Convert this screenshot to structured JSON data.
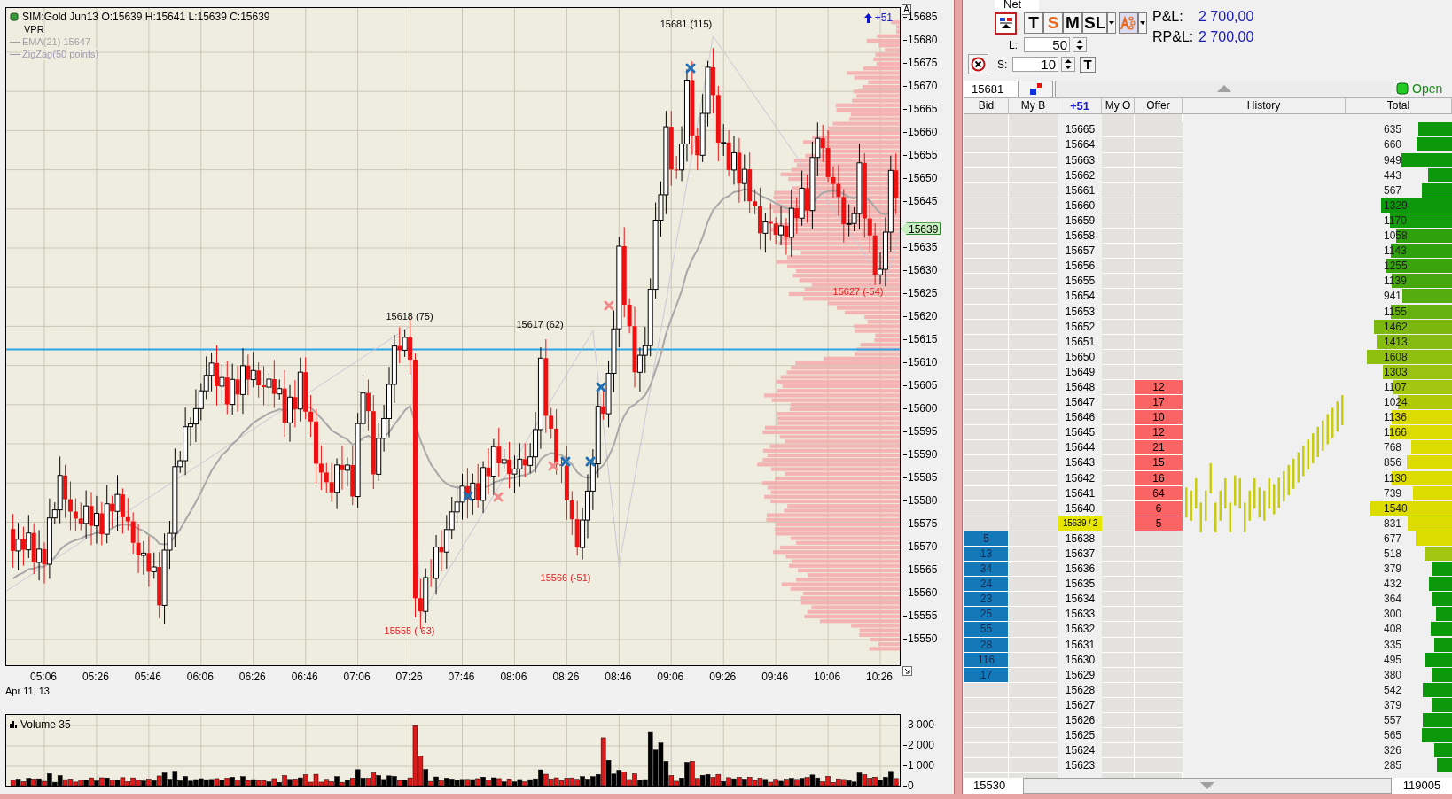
{
  "chart": {
    "legend": {
      "instrument": "SIM:Gold Jun13 O:15639 H:15641 L:15639 C:15639",
      "indicators": [
        {
          "label": "VPR",
          "kind": "plain",
          "color": "#000000"
        },
        {
          "label": "EMA(21)  15647",
          "kind": "line",
          "color": "#a0a0a0"
        },
        {
          "label": "ZigZag(50 points)",
          "kind": "line",
          "color": "#9a9ab4"
        }
      ]
    },
    "position_change": "+51",
    "axis_button": "A",
    "y_axis_labels": [
      "15685",
      "15680",
      "15675",
      "15670",
      "15665",
      "15660",
      "15655",
      "15650",
      "15645",
      "15635",
      "15630",
      "15625",
      "15620",
      "15615",
      "15610",
      "15605",
      "15600",
      "15595",
      "15590",
      "15585",
      "15580",
      "15575",
      "15570",
      "15565",
      "15560",
      "15555",
      "15550"
    ],
    "price_tag": "15639",
    "annotations": [
      "15681 (115)",
      "15618 (75)",
      "15617 (62)",
      "15555 (-63)",
      "15566 (-51)",
      "15627 (-54)"
    ],
    "time_labels": [
      "05:06",
      "05:26",
      "05:46",
      "06:06",
      "06:26",
      "06:46",
      "07:06",
      "07:26",
      "07:46",
      "08:06",
      "08:26",
      "08:46",
      "09:06",
      "09:26",
      "09:46",
      "10:06",
      "10:26"
    ],
    "date_label": "Apr 11, 13",
    "volume": {
      "title": "Volume 35",
      "y_axis_labels": [
        "3 000",
        "2 000",
        "1 000",
        "0"
      ]
    }
  },
  "order_entry": {
    "account": "Net",
    "buttons": [
      {
        "label": "T",
        "color": "#000000"
      },
      {
        "label": "S",
        "color": "#e8661a"
      },
      {
        "label": "M",
        "color": "#000000"
      },
      {
        "label": "SL",
        "color": "#000000"
      }
    ],
    "pnl_label": "P&L:",
    "pnl": "2 700,00",
    "rpnl_label": "RP&L:",
    "rpnl": "2 700,00",
    "long_label": "L:",
    "long_qty": "50",
    "short_label": "S:",
    "short_qty": "10",
    "trail_button": "T"
  },
  "ladder": {
    "top_price": "15681",
    "status": "Open",
    "columns": [
      {
        "label": "Bid",
        "kind": "plain"
      },
      {
        "label": "My B",
        "kind": "plain"
      },
      {
        "label": "+51",
        "kind": "position"
      },
      {
        "label": "My O",
        "kind": "plain"
      },
      {
        "label": "Offer",
        "kind": "plain"
      },
      {
        "label": "History",
        "kind": "plain"
      },
      {
        "label": "Total",
        "kind": "plain"
      }
    ],
    "rows": [
      {
        "price": "15665",
        "total": "635",
        "color": "#0b990b",
        "current": false
      },
      {
        "price": "15664",
        "total": "660",
        "color": "#0b990b",
        "current": false
      },
      {
        "price": "15663",
        "total": "949",
        "color": "#0b990b",
        "current": false
      },
      {
        "price": "15662",
        "total": "443",
        "color": "#0b990b",
        "current": false
      },
      {
        "price": "15661",
        "total": "567",
        "color": "#0b990b",
        "current": false
      },
      {
        "price": "15660",
        "total": "1329",
        "color": "#0b990b",
        "current": false
      },
      {
        "price": "15659",
        "total": "1170",
        "color": "#139c0b",
        "current": false
      },
      {
        "price": "15658",
        "total": "1058",
        "color": "#2ea10c",
        "current": false
      },
      {
        "price": "15657",
        "total": "1143",
        "color": "#2ea10c",
        "current": false
      },
      {
        "price": "15656",
        "total": "1255",
        "color": "#3aa40d",
        "current": false
      },
      {
        "price": "15655",
        "total": "1139",
        "color": "#45a70e",
        "current": false
      },
      {
        "price": "15654",
        "total": "941",
        "color": "#55ac0e",
        "current": false
      },
      {
        "price": "15653",
        "total": "1155",
        "color": "#68b20f",
        "current": false
      },
      {
        "price": "15652",
        "total": "1462",
        "color": "#7ab80f",
        "current": false
      },
      {
        "price": "15651",
        "total": "1413",
        "color": "#86bc10",
        "current": false
      },
      {
        "price": "15650",
        "total": "1608",
        "color": "#8fc010",
        "current": false
      },
      {
        "price": "15649",
        "total": "1303",
        "color": "#98c310",
        "current": false
      },
      {
        "price": "15648",
        "offer": "12",
        "total": "1107",
        "color": "#a3c610",
        "current": false
      },
      {
        "price": "15647",
        "offer": "17",
        "total": "1024",
        "color": "#b0ca08",
        "current": false
      },
      {
        "price": "15646",
        "offer": "10",
        "total": "1136",
        "color": "#dcdc00",
        "current": false
      },
      {
        "price": "15645",
        "offer": "12",
        "total": "1166",
        "color": "#dcdc00",
        "current": false
      },
      {
        "price": "15644",
        "offer": "21",
        "total": "768",
        "color": "#dcdc00",
        "current": false
      },
      {
        "price": "15643",
        "offer": "15",
        "total": "856",
        "color": "#dcdc00",
        "current": false
      },
      {
        "price": "15642",
        "offer": "16",
        "total": "1130",
        "color": "#dcdc00",
        "current": false
      },
      {
        "price": "15641",
        "offer": "64",
        "total": "739",
        "color": "#dcdc00",
        "current": false
      },
      {
        "price": "15640",
        "offer": "6",
        "total": "1540",
        "color": "#dcdc00",
        "current": false
      },
      {
        "price": "15639 / 2",
        "offer": "5",
        "total": "831",
        "color": "#dcdc00",
        "current": true
      },
      {
        "price": "15638",
        "bid": "5",
        "total": "677",
        "color": "#dcdc00",
        "current": false
      },
      {
        "price": "15637",
        "bid": "13",
        "total": "518",
        "color": "#a3c610",
        "current": false
      },
      {
        "price": "15636",
        "bid": "34",
        "total": "379",
        "color": "#0b990b",
        "current": false
      },
      {
        "price": "15635",
        "bid": "24",
        "total": "432",
        "color": "#0b990b",
        "current": false
      },
      {
        "price": "15634",
        "bid": "23",
        "total": "364",
        "color": "#0b990b",
        "current": false
      },
      {
        "price": "15633",
        "bid": "25",
        "total": "300",
        "color": "#0b990b",
        "current": false
      },
      {
        "price": "15632",
        "bid": "55",
        "total": "408",
        "color": "#0b990b",
        "current": false
      },
      {
        "price": "15631",
        "bid": "28",
        "total": "335",
        "color": "#0b990b",
        "current": false
      },
      {
        "price": "15630",
        "bid": "116",
        "total": "495",
        "color": "#0b990b",
        "current": false
      },
      {
        "price": "15629",
        "bid": "17",
        "total": "380",
        "color": "#0b990b",
        "current": false
      },
      {
        "price": "15628",
        "total": "542",
        "color": "#0b990b",
        "current": false
      },
      {
        "price": "15627",
        "total": "379",
        "color": "#0b990b",
        "current": false
      },
      {
        "price": "15626",
        "total": "557",
        "color": "#0b990b",
        "current": false
      },
      {
        "price": "15625",
        "total": "565",
        "color": "#0b990b",
        "current": false
      },
      {
        "price": "15624",
        "total": "326",
        "color": "#0b990b",
        "current": false
      },
      {
        "price": "15623",
        "total": "285",
        "color": "#0b990b",
        "current": false
      }
    ],
    "bottom_price": "15530",
    "total_volume": "119005"
  }
}
